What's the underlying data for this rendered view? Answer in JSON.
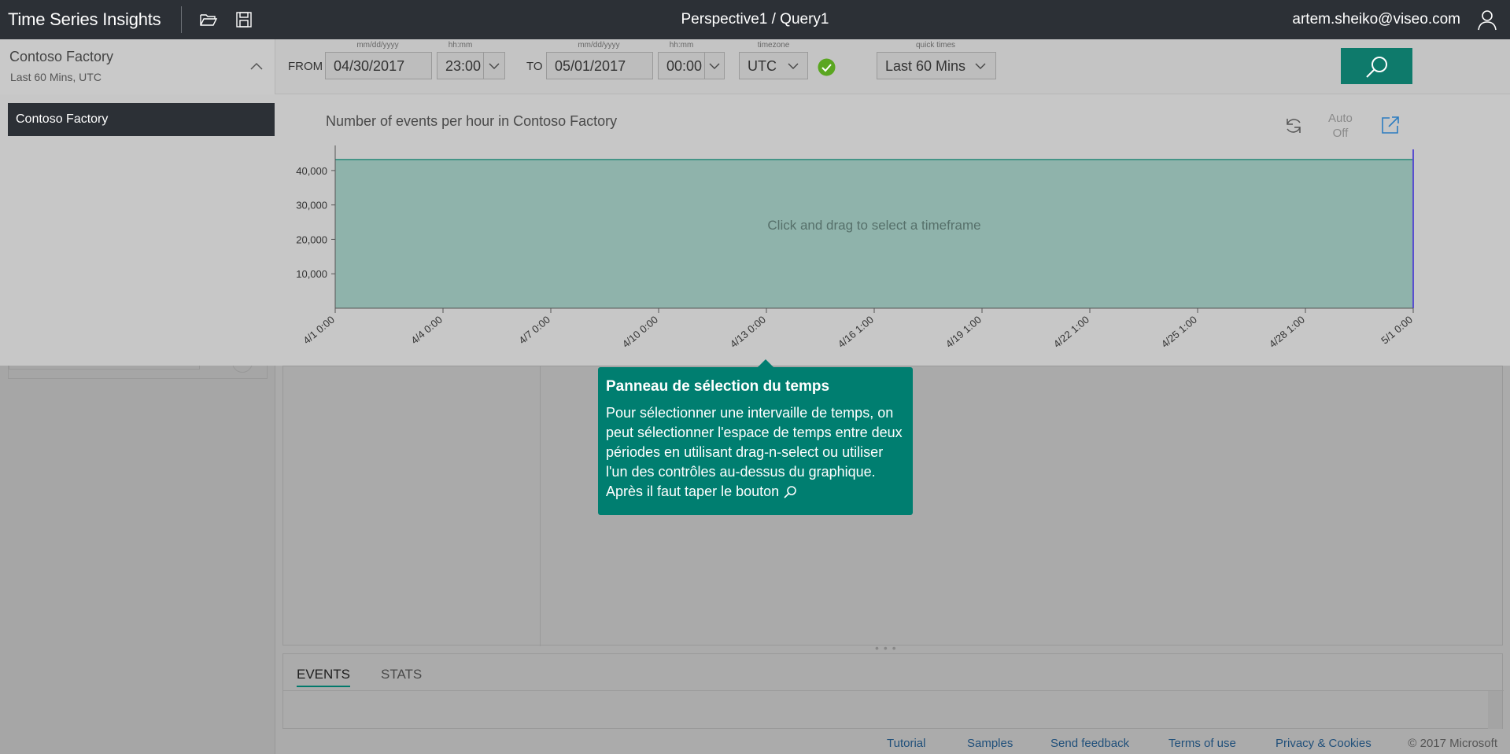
{
  "app": {
    "title": "Time Series Insights",
    "breadcrumb": "Perspective1 / Query1",
    "user": "artem.sheiko@viseo.com"
  },
  "environment": {
    "name": "Contoso Factory",
    "subtitle": "Last 60 Mins, UTC",
    "selected_item": "Contoso Factory"
  },
  "time_controls": {
    "from_label": "FROM",
    "to_label": "TO",
    "date_caption": "mm/dd/yyyy",
    "time_caption": "hh:mm",
    "timezone_caption": "timezone",
    "quick_caption": "quick times",
    "from_date": "04/30/2017",
    "from_time": "23:00",
    "to_date": "05/01/2017",
    "to_time": "00:00",
    "timezone": "UTC",
    "quick_time": "Last 60 Mins"
  },
  "chart_panel": {
    "auto_label": "Auto",
    "auto_state": "Off",
    "hint": "Click and drag to select a timeframe"
  },
  "chart_data": {
    "type": "area",
    "title": "Number of events per hour in Contoso Factory",
    "x": [
      "4/1 0:00",
      "4/4 0:00",
      "4/7 0:00",
      "4/10 0:00",
      "4/13 0:00",
      "4/16 1:00",
      "4/19 1:00",
      "4/22 1:00",
      "4/25 1:00",
      "4/28 1:00",
      "5/1 0:00"
    ],
    "series": [
      {
        "values": [
          43200,
          43200,
          43200,
          43200,
          43200,
          43200,
          43200,
          43200,
          43200,
          43200,
          43200
        ]
      }
    ],
    "yticks": [
      "10,000",
      "20,000",
      "30,000",
      "40,000"
    ],
    "ylim": [
      0,
      45000
    ],
    "colors": {
      "fill": "#8fb3ab",
      "line": "#2a8a7a"
    }
  },
  "tooltip": {
    "title": "Panneau de sélection du temps",
    "body": "Pour sélectionner une intervaille de temps, on peut sélectionner l'espace de temps entre deux périodes en utilisant drag-n-select ou utiliser l'un des contrôles au-dessus du graphique. Après il faut taper le bouton"
  },
  "bottom_tabs": [
    "EVENTS",
    "STATS"
  ],
  "footer": {
    "links": [
      "Tutorial",
      "Samples",
      "Send feedback",
      "Terms of use",
      "Privacy & Cookies"
    ],
    "copyright": "© 2017 Microsoft"
  }
}
